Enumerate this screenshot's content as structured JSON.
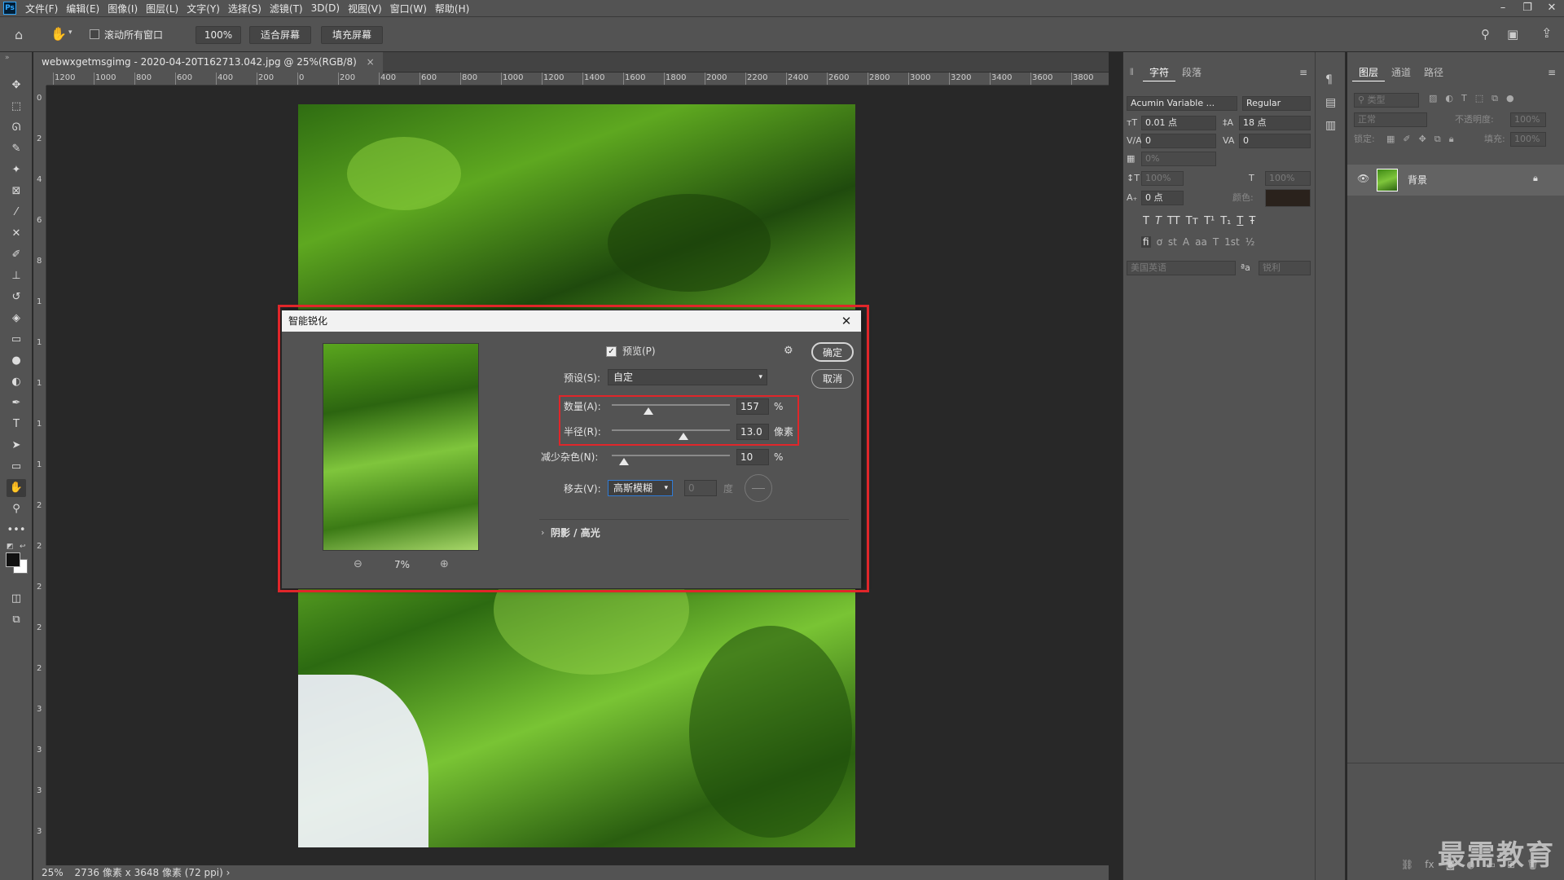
{
  "app": {
    "logo": "Ps"
  },
  "menu": [
    "文件(F)",
    "编辑(E)",
    "图像(I)",
    "图层(L)",
    "文字(Y)",
    "选择(S)",
    "滤镜(T)",
    "3D(D)",
    "视图(V)",
    "窗口(W)",
    "帮助(H)"
  ],
  "options_bar": {
    "scroll_all_label": "滚动所有窗口",
    "zoom_value": "100%",
    "fit_screen": "适合屏幕",
    "fill_screen": "填充屏幕"
  },
  "document": {
    "tab_title": "webwxgetmsgimg - 2020-04-20T162713.042.jpg @ 25%(RGB/8)",
    "tab_close": "×"
  },
  "ruler": {
    "h_labels": [
      "1200",
      "1000",
      "800",
      "600",
      "400",
      "200",
      "0",
      "200",
      "400",
      "600",
      "800",
      "1000",
      "1200",
      "1400",
      "1600",
      "1800",
      "2000",
      "2200",
      "2400",
      "2600",
      "2800",
      "3000",
      "3200",
      "3400",
      "3600",
      "3800"
    ],
    "v_labels": [
      "0",
      "2",
      "4",
      "6",
      "8",
      "1",
      "1",
      "1",
      "1",
      "1",
      "2",
      "2",
      "2",
      "2",
      "2",
      "3",
      "3",
      "3",
      "3"
    ]
  },
  "status": {
    "zoom": "25%",
    "info": "2736 像素 x 3648 像素 (72 ppi)"
  },
  "character_panel": {
    "tabs": [
      "字符",
      "段落"
    ],
    "font_family": "Acumin Variable ...",
    "font_style": "Regular",
    "font_size": "0.01 点",
    "leading": "18 点",
    "kerning": "0",
    "tracking": "0",
    "tsume": "0%",
    "vscale": "100%",
    "hscale": "100%",
    "baseline": "0 点",
    "color_label": "颜色:",
    "language": "美国英语",
    "aa_label": "ªa",
    "antialias": "锐利",
    "style_glyphs": [
      "T",
      "T",
      "TT",
      "Tт",
      "T¹",
      "T₁",
      "T",
      "Ŧ"
    ],
    "ot_glyphs": [
      "fi",
      "ơ",
      "st",
      "A",
      "aa",
      "T",
      "1st",
      "½"
    ]
  },
  "layers_panel": {
    "tabs": [
      "图层",
      "通道",
      "路径"
    ],
    "filter_placeholder": "类型",
    "blend_mode": "正常",
    "opacity_label": "不透明度:",
    "opacity": "100%",
    "lock_label": "锁定:",
    "fill_label": "填充:",
    "fill": "100%",
    "layer_name": "背景"
  },
  "dialog": {
    "title": "智能锐化",
    "preview_label": "预览(P)",
    "ok": "确定",
    "cancel": "取消",
    "preset_label": "预设(S):",
    "preset_value": "自定",
    "amount_label": "数量(A):",
    "amount_value": "157",
    "amount_unit": "%",
    "amount_fraction": 0.31,
    "radius_label": "半径(R):",
    "radius_value": "13.0",
    "radius_unit": "像素",
    "radius_fraction": 0.61,
    "noise_label": "减少杂色(N):",
    "noise_value": "10",
    "noise_unit": "%",
    "noise_fraction": 0.1,
    "remove_label": "移去(V):",
    "remove_value": "高斯模糊",
    "angle_value": "0",
    "angle_unit": "度",
    "shadow_highlight": "阴影 / 高光",
    "zoom_pct": "7%"
  },
  "watermark": "最需教育",
  "colors": {
    "highlight": "#e0262a",
    "panel": "#535353",
    "canvas_bg": "#282828"
  }
}
